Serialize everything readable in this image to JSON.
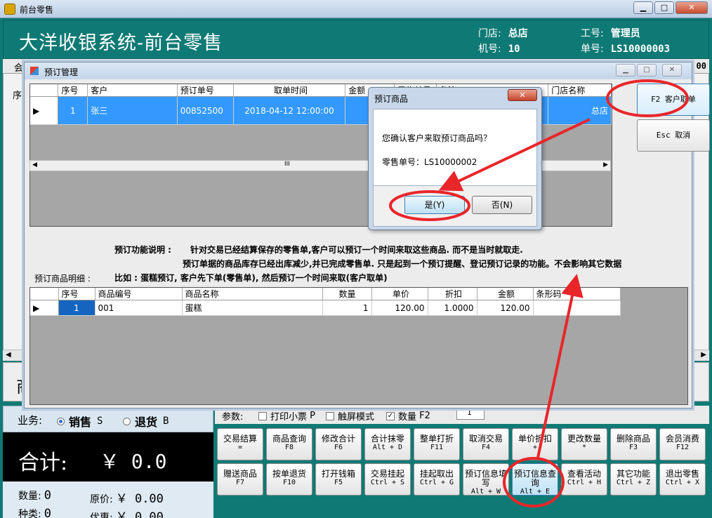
{
  "main_window": {
    "title": "前台零售",
    "minimize": "▁",
    "maximize": "□",
    "close": "✕"
  },
  "header": {
    "system_title": "大洋收银系统-前台零售",
    "store_label": "门店:",
    "store_value": "总店",
    "staff_label": "工号:",
    "staff_value": "管理员",
    "machine_label": "机号:",
    "machine_value": "10",
    "order_label": "单号:",
    "order_value": "LS10000003"
  },
  "background": {
    "left_label_1": "会",
    "left_label_2": "序",
    "amount_fragment": "00",
    "big_fragment": "商"
  },
  "business": {
    "label": "业务:",
    "sale": "销售",
    "sale_key": "S",
    "return": "退货",
    "return_key": "B"
  },
  "total": {
    "label": "合计:",
    "value": "￥ 0.0"
  },
  "stats": {
    "qty_label": "数量:",
    "qty_value": "0",
    "orig_price_label": "原价:",
    "orig_price_value": "￥ 0.00",
    "kinds_label": "种类:",
    "kinds_value": "0",
    "discount_label": "优惠:",
    "discount_value": "￥ 0.00"
  },
  "params": {
    "label": "参数:",
    "print_receipt": "打印小票",
    "print_receipt_key": "P",
    "touch_mode": "触屏模式",
    "quantity": "数量",
    "quantity_key": "F2",
    "quantity_value": "1"
  },
  "function_buttons": [
    {
      "label": "交易结算",
      "key": "="
    },
    {
      "label": "商品查询",
      "key": "F8"
    },
    {
      "label": "修改合计",
      "key": "F6"
    },
    {
      "label": "合计抹零",
      "key": "Alt + D"
    },
    {
      "label": "整单打折",
      "key": "F11"
    },
    {
      "label": "取消交易",
      "key": "F4"
    },
    {
      "label": "单价折扣",
      "key": "+"
    },
    {
      "label": "更改数量",
      "key": "*"
    },
    {
      "label": "删除商品",
      "key": "F3"
    },
    {
      "label": "会员消费",
      "key": "F12"
    },
    {
      "label": "赠送商品",
      "key": "F7"
    },
    {
      "label": "按单退货",
      "key": "F10"
    },
    {
      "label": "打开钱箱",
      "key": "F5"
    },
    {
      "label": "交易挂起",
      "key": "Ctrl + S"
    },
    {
      "label": "挂起取出",
      "key": "Ctrl + G"
    },
    {
      "label": "预订信息填写",
      "key": "Alt + W"
    },
    {
      "label": "预订信息查询",
      "key": "Alt + E"
    },
    {
      "label": "查看活动",
      "key": "Ctrl + H"
    },
    {
      "label": "其它功能",
      "key": "Ctrl + Z"
    },
    {
      "label": "退出零售",
      "key": "Ctrl + X"
    }
  ],
  "reservation_window": {
    "title": "预订管理",
    "columns": [
      "序号",
      "客户",
      "预订单号",
      "取单时间",
      "金额",
      "零售单号",
      "备注",
      "门店名称"
    ],
    "rows": [
      {
        "seq": "1",
        "customer": "张三",
        "order_no": "00852500",
        "pickup_time": "2018-04-12 12:00:00",
        "store": "总店"
      }
    ],
    "btn_pickup": "F2 客户取单",
    "btn_cancel": "Esc 取消",
    "scroll_mid": "III",
    "desc_label": "预订功能说明 :",
    "desc_line1": "针对交易已经结算保存的零售单,客户可以预订一个时间来取这些商品. 而不是当时就取走.",
    "desc_line2": "预订单据的商品库存已经出库减少,并已完成零售单. 只是起到一个预订提醒、登记预订记录的功能。不会影响其它数据",
    "desc_line3": "比如 : 蛋糕预订, 客户先下单(零售单), 然后预订一个时间来取(客户取单)",
    "detail_label": "预订商品明细 :",
    "detail_columns": [
      "序号",
      "商品编号",
      "商品名称",
      "数量",
      "单价",
      "折扣",
      "金额",
      "条形码"
    ],
    "detail_rows": [
      {
        "seq": "1",
        "code": "001",
        "name": "蛋糕",
        "qty": "1",
        "price": "120.00",
        "discount": "1.0000",
        "amount": "120.00",
        "barcode": ""
      }
    ]
  },
  "confirm_dialog": {
    "title": "预订商品",
    "close": "✕",
    "message": "您确认客户来取预订商品吗？",
    "order_line": "零售单号：LS10000002",
    "yes": "是(Y)",
    "no": "否(N)"
  },
  "annotation_color": "#e8262a"
}
